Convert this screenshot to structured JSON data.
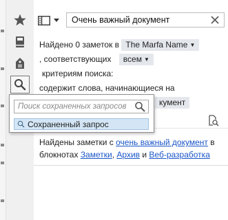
{
  "colors": {
    "accent": "#1a55c9",
    "pill_bg": "#e4e7ec",
    "selection_bg": "#d4e6f6"
  },
  "sidebar": {
    "items": [
      {
        "name": "shortcuts",
        "icon": "star-icon"
      },
      {
        "name": "notebooks",
        "icon": "notebook-icon"
      },
      {
        "name": "tags",
        "icon": "tag-icon"
      },
      {
        "name": "saved-searches",
        "icon": "search-icon",
        "active": true
      }
    ]
  },
  "toolbar": {
    "view_icon": "list-view-icon",
    "search_query": "Очень важный документ"
  },
  "results": {
    "found_prefix": "Найдено 0 заметок в",
    "notebook_select": "The Marfa Name",
    "match_prefix": ", соответствующих",
    "match_select": "всем",
    "criteria_suffix": "критериям поиска:",
    "condition_line": "содержит слова, начинающиеся на",
    "condition_value_visible": "кумент"
  },
  "found_message": {
    "prefix": "Найдены заметки с",
    "query_link": "очень важный документ",
    "middle": "в блокнотах",
    "notebook_1": "Заметки",
    "comma": ",",
    "notebook_2": "Архив",
    "and": "и",
    "notebook_3": "Веб-разработка"
  },
  "saved_search_popup": {
    "placeholder": "Поиск сохраненных запросов",
    "items": [
      {
        "label": "Сохраненный запрос"
      }
    ]
  }
}
